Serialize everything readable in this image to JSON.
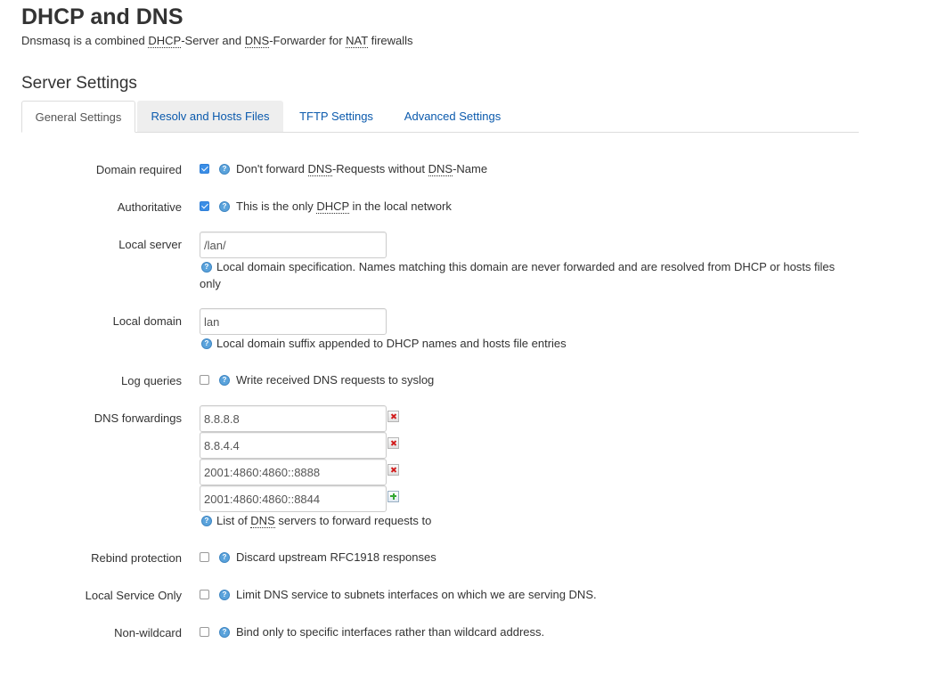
{
  "header": {
    "title": "DHCP and DNS",
    "desc_1": "Dnsmasq is a combined ",
    "desc_dhcp": "DHCP",
    "desc_2": "-Server and ",
    "desc_dns": "DNS",
    "desc_3": "-Forwarder for ",
    "desc_nat": "NAT",
    "desc_4": " firewalls"
  },
  "section": {
    "title": "Server Settings"
  },
  "tabs": [
    {
      "label": "General Settings",
      "active": true
    },
    {
      "label": "Resolv and Hosts Files"
    },
    {
      "label": "TFTP Settings"
    },
    {
      "label": "Advanced Settings"
    }
  ],
  "fields": {
    "domain_required": {
      "label": "Domain required",
      "checked": true,
      "desc_a": "Don't forward ",
      "abbr_1": "DNS",
      "desc_b": "-Requests without ",
      "abbr_2": "DNS",
      "desc_c": "-Name"
    },
    "authoritative": {
      "label": "Authoritative",
      "checked": true,
      "desc_a": "This is the only ",
      "abbr": "DHCP",
      "desc_b": " in the local network"
    },
    "local_server": {
      "label": "Local server",
      "value": "/lan/",
      "desc": "Local domain specification. Names matching this domain are never forwarded and are resolved from DHCP or hosts files only"
    },
    "local_domain": {
      "label": "Local domain",
      "value": "lan",
      "desc": "Local domain suffix appended to DHCP names and hosts file entries"
    },
    "log_queries": {
      "label": "Log queries",
      "checked": false,
      "desc": "Write received DNS requests to syslog"
    },
    "dns_forwardings": {
      "label": "DNS forwardings",
      "values": [
        "8.8.8.8",
        "8.8.4.4",
        "2001:4860:4860::8888",
        "2001:4860:4860::8844"
      ],
      "desc_a": "List of ",
      "abbr": "DNS",
      "desc_b": " servers to forward requests to"
    },
    "rebind_protection": {
      "label": "Rebind protection",
      "checked": false,
      "desc": "Discard upstream RFC1918 responses"
    },
    "local_service_only": {
      "label": "Local Service Only",
      "checked": false,
      "desc": "Limit DNS service to subnets interfaces on which we are serving DNS."
    },
    "non_wildcard": {
      "label": "Non-wildcard",
      "checked": false,
      "desc": "Bind only to specific interfaces rather than wildcard address."
    }
  },
  "icons": {
    "help": "help-icon",
    "remove": "remove-icon",
    "add": "add-icon"
  },
  "colors": {
    "link": "#0b5aad",
    "checkbox": "#3b8ee6",
    "help": "#5aa3dc"
  }
}
